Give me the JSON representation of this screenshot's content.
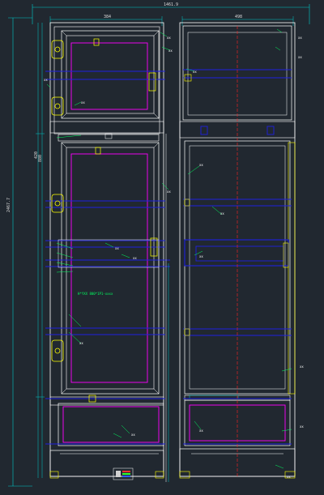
{
  "dimensions": {
    "overall_width": "1461.9",
    "overall_height": "2467.7",
    "left_cabinet_width": "384",
    "right_cabinet_width": "498",
    "left_side_small": "420",
    "left_side_small_2": "880"
  },
  "annotation": {
    "center_note": "H*YXX 800*1P1-xxxx"
  },
  "callout_text": "xx",
  "colors": {
    "background": "#212830",
    "frame": "#ffffff",
    "panel": "#ff00ff",
    "rail": "#1e20e0",
    "hardware": "#ffff00",
    "centerline": "#ff2020",
    "leader": "#00ff60",
    "dimension": "#00ffff"
  }
}
